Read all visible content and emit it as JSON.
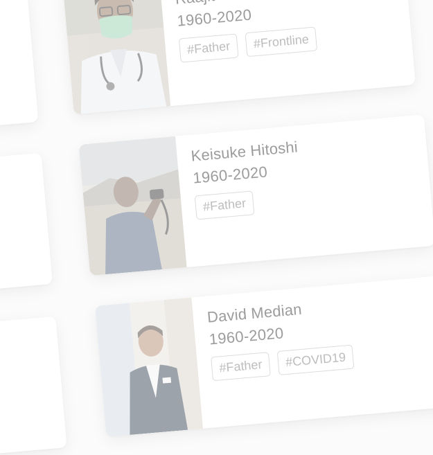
{
  "cards": [
    {
      "name": "Raajit Vihara",
      "years": "1960-2020",
      "tags": [
        "#Father",
        "#Frontline"
      ]
    },
    {
      "name": "Keisuke Hitoshi",
      "years": "1960-2020",
      "tags": [
        "#Father"
      ]
    },
    {
      "name": "David Median",
      "years": "1960-2020",
      "tags": [
        "#Father",
        "#COVID19"
      ]
    }
  ],
  "colors": {
    "background": "#fbfbfb",
    "card": "#ffffff",
    "text": "#9c9c9c",
    "tag_text": "#bdbdbd",
    "tag_border": "#dcdcdc"
  },
  "icons": [
    "doctor-photo",
    "photographer-photo",
    "businessman-photo"
  ]
}
